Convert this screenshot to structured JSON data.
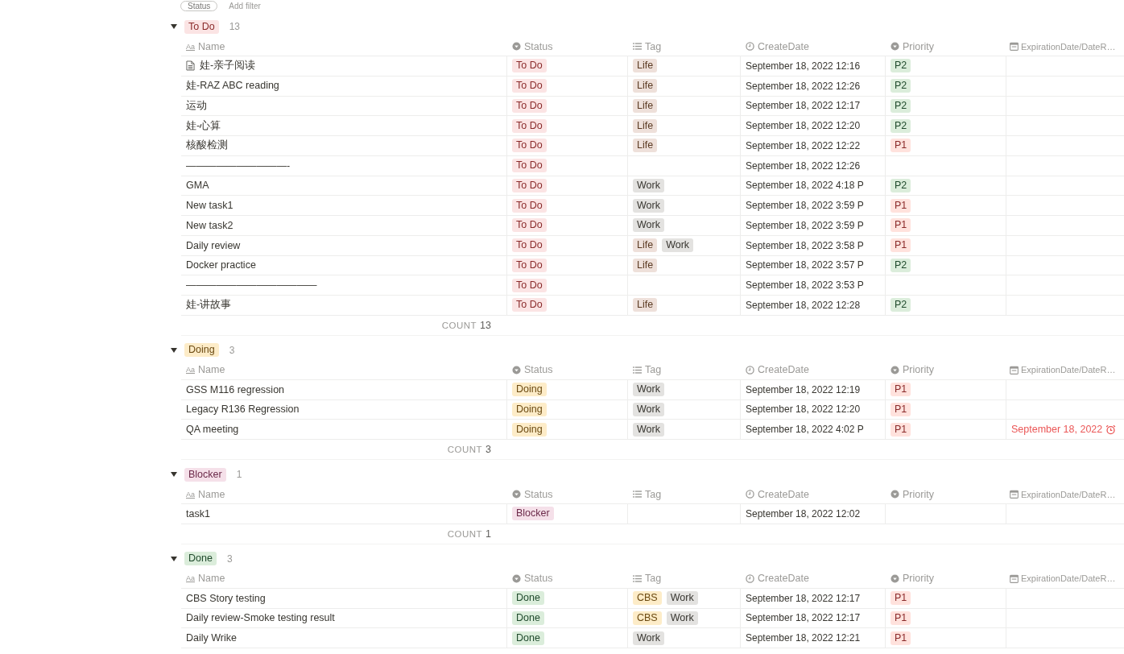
{
  "filter_bar": {
    "chip": "Status",
    "add": "Add filter"
  },
  "groups": [
    {
      "status": {
        "label": "To Do",
        "color": "#fbe4e4"
      },
      "count": "13",
      "expanded": true,
      "columns": [
        {
          "label": "Name",
          "kind": "title",
          "glyph": "Aa"
        },
        {
          "label": "Status",
          "kind": "select"
        },
        {
          "label": "Tag",
          "kind": "multi_select"
        },
        {
          "label": "CreateDate",
          "kind": "created_time"
        },
        {
          "label": "Priority",
          "kind": "select"
        },
        {
          "label": "ExpirationDate/DateR…",
          "kind": "date"
        }
      ],
      "rows": [
        {
          "name": "娃-亲子阅读",
          "page_icon": true,
          "status": {
            "label": "To Do",
            "color": "#fbe4e4"
          },
          "tags": [
            {
              "label": "Life",
              "color": "#eee0da"
            }
          ],
          "create_date": "September 18, 2022 12:16",
          "priority": {
            "label": "P2",
            "color": "#dbeddb"
          }
        },
        {
          "name": "娃-RAZ ABC reading",
          "status": {
            "label": "To Do",
            "color": "#fbe4e4"
          },
          "tags": [
            {
              "label": "Life",
              "color": "#eee0da"
            }
          ],
          "create_date": "September 18, 2022 12:26",
          "priority": {
            "label": "P2",
            "color": "#dbeddb"
          }
        },
        {
          "name": "运动",
          "status": {
            "label": "To Do",
            "color": "#fbe4e4"
          },
          "tags": [
            {
              "label": "Life",
              "color": "#eee0da"
            }
          ],
          "create_date": "September 18, 2022 12:17",
          "priority": {
            "label": "P2",
            "color": "#dbeddb"
          }
        },
        {
          "name": "娃-心算",
          "status": {
            "label": "To Do",
            "color": "#fbe4e4"
          },
          "tags": [
            {
              "label": "Life",
              "color": "#eee0da"
            }
          ],
          "create_date": "September 18, 2022 12:20",
          "priority": {
            "label": "P2",
            "color": "#dbeddb"
          }
        },
        {
          "name": "核酸检测",
          "status": {
            "label": "To Do",
            "color": "#fbe4e4"
          },
          "tags": [
            {
              "label": "Life",
              "color": "#eee0da"
            }
          ],
          "create_date": "September 18, 2022 12:22",
          "priority": {
            "label": "P1",
            "color": "#ffe2dd"
          }
        },
        {
          "name": "——————————-",
          "status": {
            "label": "To Do",
            "color": "#fbe4e4"
          },
          "tags": [],
          "create_date": "September 18, 2022 12:26"
        },
        {
          "name": "GMA",
          "status": {
            "label": "To Do",
            "color": "#fbe4e4"
          },
          "tags": [
            {
              "label": "Work",
              "color": "#e3e2e0"
            }
          ],
          "create_date": "September 18, 2022 4:18 P",
          "priority": {
            "label": "P2",
            "color": "#dbeddb"
          }
        },
        {
          "name": "New task1",
          "status": {
            "label": "To Do",
            "color": "#fbe4e4"
          },
          "tags": [
            {
              "label": "Work",
              "color": "#e3e2e0"
            }
          ],
          "create_date": "September 18, 2022 3:59 P",
          "priority": {
            "label": "P1",
            "color": "#ffe2dd"
          }
        },
        {
          "name": "New task2",
          "status": {
            "label": "To Do",
            "color": "#fbe4e4"
          },
          "tags": [
            {
              "label": "Work",
              "color": "#e3e2e0"
            }
          ],
          "create_date": "September 18, 2022 3:59 P",
          "priority": {
            "label": "P1",
            "color": "#ffe2dd"
          }
        },
        {
          "name": "Daily review",
          "status": {
            "label": "To Do",
            "color": "#fbe4e4"
          },
          "tags": [
            {
              "label": "Life",
              "color": "#eee0da"
            },
            {
              "label": "Work",
              "color": "#e3e2e0"
            }
          ],
          "create_date": "September 18, 2022 3:58 P",
          "priority": {
            "label": "P1",
            "color": "#ffe2dd"
          }
        },
        {
          "name": "Docker practice",
          "status": {
            "label": "To Do",
            "color": "#fbe4e4"
          },
          "tags": [
            {
              "label": "Life",
              "color": "#eee0da"
            }
          ],
          "create_date": "September 18, 2022 3:57 P",
          "priority": {
            "label": "P2",
            "color": "#dbeddb"
          }
        },
        {
          "name": "—————————————",
          "status": {
            "label": "To Do",
            "color": "#fbe4e4"
          },
          "tags": [],
          "create_date": "September 18, 2022 3:53 P"
        },
        {
          "name": "娃-讲故事",
          "status": {
            "label": "To Do",
            "color": "#fbe4e4"
          },
          "tags": [
            {
              "label": "Life",
              "color": "#eee0da"
            }
          ],
          "create_date": "September 18, 2022 12:28",
          "priority": {
            "label": "P2",
            "color": "#dbeddb"
          }
        }
      ],
      "footer": {
        "label": "COUNT",
        "value": "13"
      }
    },
    {
      "status": {
        "label": "Doing",
        "color": "#fdecc8"
      },
      "count": "3",
      "expanded": true,
      "columns": [
        {
          "label": "Name",
          "kind": "title",
          "glyph": "Aa"
        },
        {
          "label": "Status",
          "kind": "select"
        },
        {
          "label": "Tag",
          "kind": "multi_select"
        },
        {
          "label": "CreateDate",
          "kind": "created_time"
        },
        {
          "label": "Priority",
          "kind": "select"
        },
        {
          "label": "ExpirationDate/DateR…",
          "kind": "date"
        }
      ],
      "rows": [
        {
          "name": "GSS M116 regression",
          "status": {
            "label": "Doing",
            "color": "#fdecc8"
          },
          "tags": [
            {
              "label": "Work",
              "color": "#e3e2e0"
            }
          ],
          "create_date": "September 18, 2022 12:19",
          "priority": {
            "label": "P1",
            "color": "#ffe2dd"
          }
        },
        {
          "name": "Legacy R136 Regression",
          "status": {
            "label": "Doing",
            "color": "#fdecc8"
          },
          "tags": [
            {
              "label": "Work",
              "color": "#e3e2e0"
            }
          ],
          "create_date": "September 18, 2022 12:20",
          "priority": {
            "label": "P1",
            "color": "#ffe2dd"
          }
        },
        {
          "name": "QA meeting",
          "status": {
            "label": "Doing",
            "color": "#fdecc8"
          },
          "tags": [
            {
              "label": "Work",
              "color": "#e3e2e0"
            }
          ],
          "create_date": "September 18, 2022 4:02 P",
          "priority": {
            "label": "P1",
            "color": "#ffe2dd"
          },
          "expiration": {
            "text": "September 18, 2022",
            "overdue": true,
            "reminder": true
          }
        }
      ],
      "footer": {
        "label": "COUNT",
        "value": "3"
      }
    },
    {
      "status": {
        "label": "Blocker",
        "color": "#f5e0e9"
      },
      "count": "1",
      "expanded": true,
      "columns": [
        {
          "label": "Name",
          "kind": "title",
          "glyph": "Aa"
        },
        {
          "label": "Status",
          "kind": "select"
        },
        {
          "label": "Tag",
          "kind": "multi_select"
        },
        {
          "label": "CreateDate",
          "kind": "created_time"
        },
        {
          "label": "Priority",
          "kind": "select"
        },
        {
          "label": "ExpirationDate/DateR…",
          "kind": "date"
        }
      ],
      "rows": [
        {
          "name": "task1",
          "status": {
            "label": "Blocker",
            "color": "#f5e0e9"
          },
          "tags": [],
          "create_date": "September 18, 2022 12:02"
        }
      ],
      "footer": {
        "label": "COUNT",
        "value": "1"
      }
    },
    {
      "status": {
        "label": "Done",
        "color": "#dbeddb"
      },
      "count": "3",
      "expanded": true,
      "columns": [
        {
          "label": "Name",
          "kind": "title",
          "glyph": "Aa"
        },
        {
          "label": "Status",
          "kind": "select"
        },
        {
          "label": "Tag",
          "kind": "multi_select"
        },
        {
          "label": "CreateDate",
          "kind": "created_time"
        },
        {
          "label": "Priority",
          "kind": "select"
        },
        {
          "label": "ExpirationDate/DateR…",
          "kind": "date"
        }
      ],
      "rows": [
        {
          "name": "CBS Story testing",
          "status": {
            "label": "Done",
            "color": "#dbeddb"
          },
          "tags": [
            {
              "label": "CBS",
              "color": "#fdecc8"
            },
            {
              "label": "Work",
              "color": "#e3e2e0"
            }
          ],
          "create_date": "September 18, 2022 12:17",
          "priority": {
            "label": "P1",
            "color": "#ffe2dd"
          }
        },
        {
          "name": "Daily review-Smoke testing result",
          "status": {
            "label": "Done",
            "color": "#dbeddb"
          },
          "tags": [
            {
              "label": "CBS",
              "color": "#fdecc8"
            },
            {
              "label": "Work",
              "color": "#e3e2e0"
            }
          ],
          "create_date": "September 18, 2022 12:17",
          "priority": {
            "label": "P1",
            "color": "#ffe2dd"
          }
        },
        {
          "name": "Daily Wrike",
          "status": {
            "label": "Done",
            "color": "#dbeddb"
          },
          "tags": [
            {
              "label": "Work",
              "color": "#e3e2e0"
            }
          ],
          "create_date": "September 18, 2022 12:21",
          "priority": {
            "label": "P1",
            "color": "#ffe2dd"
          }
        }
      ]
    }
  ]
}
